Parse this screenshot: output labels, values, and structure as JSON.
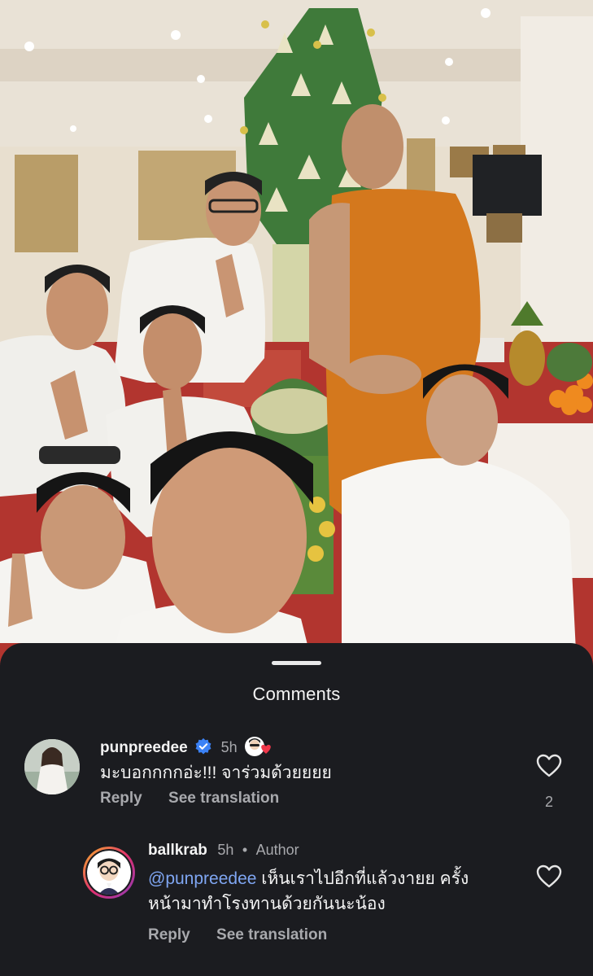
{
  "sheet": {
    "title": "Comments"
  },
  "comments": [
    {
      "username": "punpreedee",
      "verified": true,
      "time": "5h",
      "text": "มะบอกกกกอ่ะ!!! จาร่วมด้วยยยย",
      "reply_label": "Reply",
      "translate_label": "See translation",
      "likes": "2",
      "avatar_icon": "profile-photo"
    },
    {
      "username": "ballkrab",
      "time": "5h",
      "separator": "•",
      "author_label": "Author",
      "mention": "@punpreedee",
      "text_line1": " เห็นเราไปอีกที่แล้วงายย ครั้ง",
      "text_line2": "หน้ามาทำโรงทานด้วยกันนะน้อง",
      "reply_label": "Reply",
      "translate_label": "See translation",
      "avatar_icon": "cartoon-avatar"
    }
  ],
  "colors": {
    "sheet_bg": "#1b1c20",
    "mention": "#7fa6f2",
    "verified": "#3b82f6",
    "robe": "#d9781e"
  }
}
